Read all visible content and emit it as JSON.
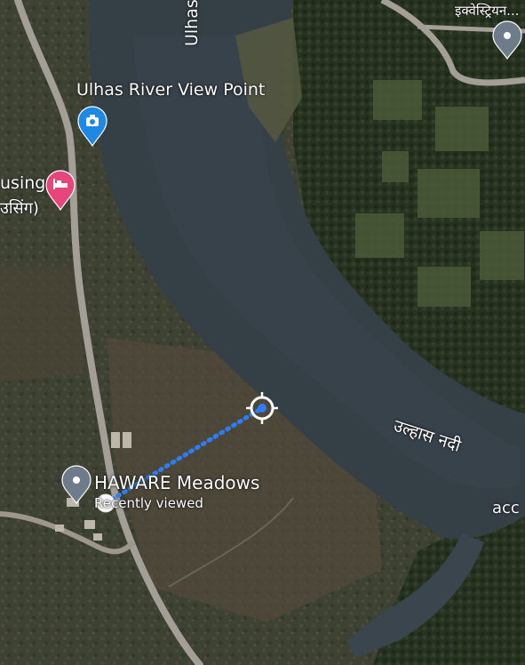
{
  "map": {
    "type": "satellite",
    "colors": {
      "river": "#353f46",
      "land": "#3d4233",
      "forest": "#24321f",
      "road": "#a39e96",
      "route": "#2f7df6",
      "pin_gray": "#6e7b8a",
      "pin_blue": "#1d88e5",
      "pin_pink": "#e8457d"
    },
    "labels": {
      "river_vertical": "Ulhas",
      "river_hindi": "उल्हास नदी",
      "viewpoint": "Ulhas River View Point",
      "housing_1": "using",
      "housing_2": "उसिंग)",
      "top_right": "इक्वेस्ट्रियन...",
      "edge_right": "acc",
      "place": "HAWARE Meadows",
      "place_sub": "Recently viewed"
    },
    "icons": {
      "viewpoint_pin": "camera-icon",
      "housing_pin": "bed-icon",
      "place_pin": "location-pin-icon",
      "topright_pin": "location-pin-icon",
      "start": "current-location-dot",
      "end": "target-crosshair-icon"
    }
  }
}
